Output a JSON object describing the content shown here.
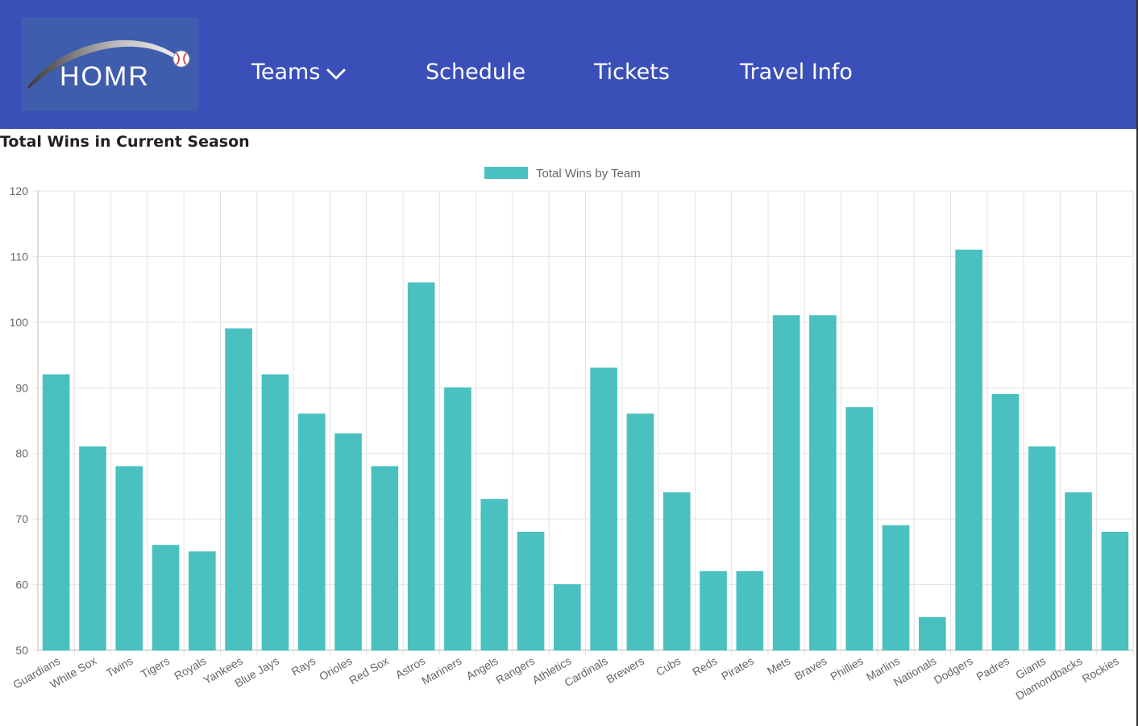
{
  "nav": {
    "logo_text": "HOMR",
    "items": [
      {
        "label": "Teams"
      },
      {
        "label": "Schedule"
      },
      {
        "label": "Tickets"
      },
      {
        "label": "Travel Info"
      }
    ]
  },
  "page": {
    "title": "Total Wins in Current Season"
  },
  "colors": {
    "navbar": "#3a50b8",
    "bar": "#4bc0c0"
  },
  "chart_data": {
    "type": "bar",
    "legend": "Total Wins by Team",
    "legend_position": "top",
    "grid": true,
    "ylim": [
      50,
      120
    ],
    "yticks": [
      50,
      60,
      70,
      80,
      90,
      100,
      110,
      120
    ],
    "categories": [
      "Guardians",
      "White Sox",
      "Twins",
      "Tigers",
      "Royals",
      "Yankees",
      "Blue Jays",
      "Rays",
      "Orioles",
      "Red Sox",
      "Astros",
      "Mariners",
      "Angels",
      "Rangers",
      "Athletics",
      "Cardinals",
      "Brewers",
      "Cubs",
      "Reds",
      "Pirates",
      "Mets",
      "Braves",
      "Phillies",
      "Marlins",
      "Nationals",
      "Dodgers",
      "Padres",
      "Giants",
      "Diamondbacks",
      "Rockies"
    ],
    "series": [
      {
        "name": "Total Wins by Team",
        "values": [
          92,
          81,
          78,
          66,
          65,
          99,
          92,
          86,
          83,
          78,
          106,
          90,
          73,
          68,
          60,
          93,
          86,
          74,
          62,
          62,
          101,
          101,
          87,
          69,
          55,
          111,
          89,
          81,
          74,
          68
        ]
      }
    ]
  }
}
